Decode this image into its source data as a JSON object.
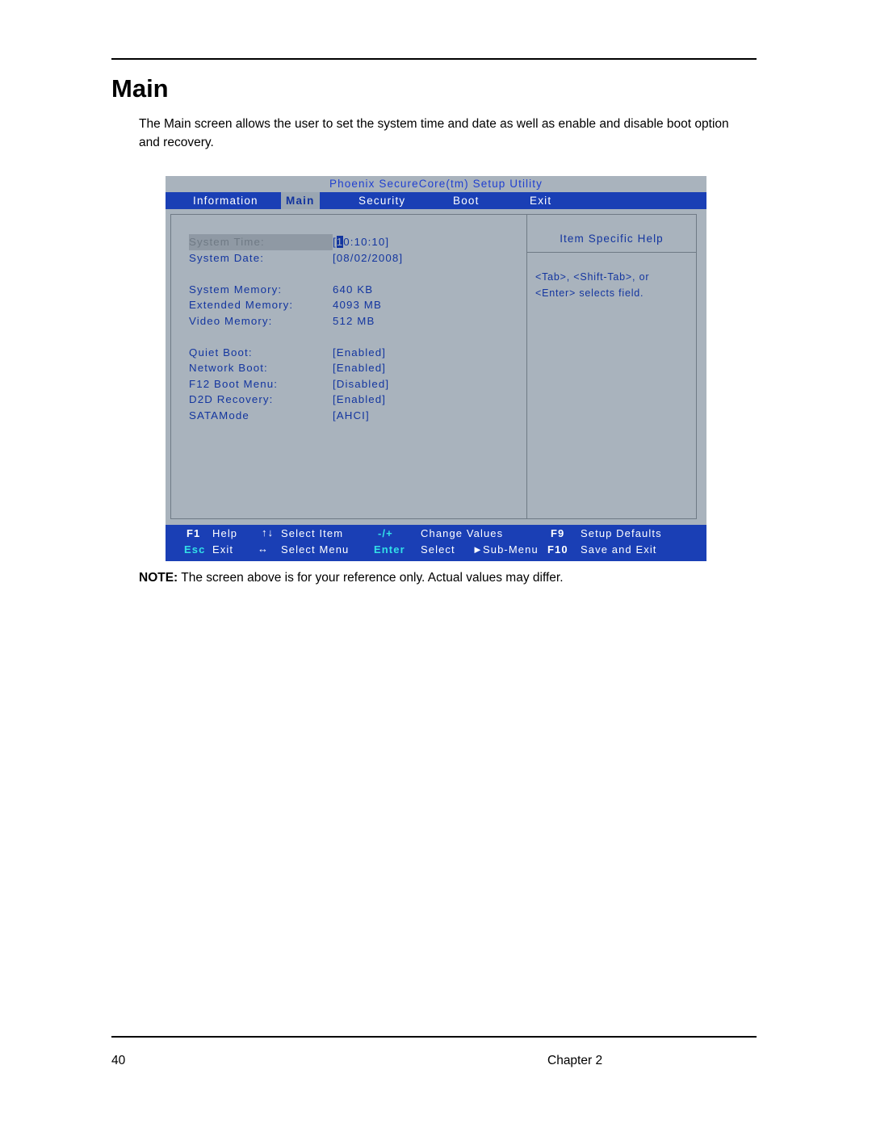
{
  "document": {
    "title": "Main",
    "intro": "The Main screen allows the user to set the system time and date as well as enable and disable boot option and recovery.",
    "note_prefix": "NOTE:",
    "note_text": " The screen above is for your reference only. Actual values may differ.",
    "page_number": "40",
    "chapter": "Chapter 2"
  },
  "bios": {
    "title": "Phoenix SecureCore(tm) Setup Utility",
    "menu": [
      {
        "label": "Information",
        "active": false
      },
      {
        "label": "Main",
        "active": true
      },
      {
        "label": "Security",
        "active": false
      },
      {
        "label": "Boot",
        "active": false
      },
      {
        "label": "Exit",
        "active": false
      }
    ],
    "rows": [
      {
        "label": "System Time:",
        "value_prefix": "[",
        "value_cursor": "1",
        "value_suffix": "0:10:10]",
        "highlight": true
      },
      {
        "label": "System Date:",
        "value": "[08/02/2008]"
      },
      {
        "label": "",
        "value": ""
      },
      {
        "label": "System Memory:",
        "value": "640 KB"
      },
      {
        "label": "Extended Memory:",
        "value": "4093 MB"
      },
      {
        "label": "Video Memory:",
        "value": "512 MB"
      },
      {
        "label": "",
        "value": ""
      },
      {
        "label": "Quiet Boot:",
        "value": "[Enabled]"
      },
      {
        "label": "Network Boot:",
        "value": "[Enabled]"
      },
      {
        "label": "F12 Boot Menu:",
        "value": "[Disabled]"
      },
      {
        "label": "D2D Recovery:",
        "value": "[Enabled]"
      },
      {
        "label": "SATAMode",
        "value": "[AHCI]"
      }
    ],
    "help": {
      "title": "Item Specific Help",
      "line1": "<Tab>, <Shift-Tab>, or",
      "line2": "<Enter> selects field."
    },
    "footer": {
      "f1_key": "F1",
      "f1_label": "Help",
      "updown_icon": "up-down-arrows",
      "updown_label": "Select Item",
      "minusplus_key": "-/+",
      "minusplus_label": "Change Values",
      "f9_key": "F9",
      "f9_label": "Setup Defaults",
      "esc_key": "Esc",
      "esc_label": "Exit",
      "leftright_icon": "left-right-arrows",
      "leftright_label": "Select Menu",
      "enter_key": "Enter",
      "enter_label": "Select",
      "submenu_label": "Sub-Menu",
      "f10_key": "F10",
      "f10_label": "Save and Exit"
    }
  }
}
